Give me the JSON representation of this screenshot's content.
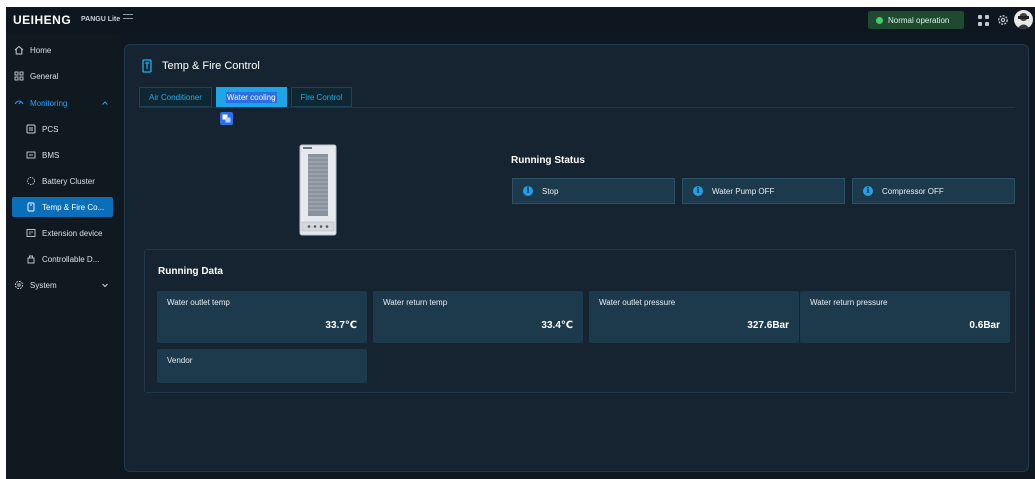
{
  "app": {
    "logo": "UEIHENG",
    "logo_sub": "PANGU Lite",
    "status": "Normal operation"
  },
  "sidebar": {
    "items": [
      {
        "label": "Home",
        "icon": "home-icon"
      },
      {
        "label": "General",
        "icon": "grid-icon"
      },
      {
        "label": "Monitoring",
        "icon": "monitor-icon"
      },
      {
        "label": "PCS",
        "icon": "pcs-icon"
      },
      {
        "label": "BMS",
        "icon": "bms-icon"
      },
      {
        "label": "Battery Cluster",
        "icon": "battery-icon"
      },
      {
        "label": "Temp & Fire Co...",
        "icon": "thermo-icon"
      },
      {
        "label": "Extension device",
        "icon": "extension-icon"
      },
      {
        "label": "Controllable D...",
        "icon": "controllable-icon"
      },
      {
        "label": "System",
        "icon": "system-icon"
      }
    ]
  },
  "panel": {
    "title": "Temp & Fire Control",
    "tabs": [
      "Air Conditioner",
      "Water cooling",
      "Fire Control"
    ],
    "active_tab": "Water cooling"
  },
  "running_status": {
    "title": "Running Status",
    "items": [
      "Stop",
      "Water Pump OFF",
      "Compressor OFF"
    ]
  },
  "running_data": {
    "title": "Running Data",
    "items": [
      {
        "label": "Water outlet temp",
        "value": "33.7℃"
      },
      {
        "label": "Water return temp",
        "value": "33.4℃"
      },
      {
        "label": "Water outlet pressure",
        "value": "327.6Bar"
      },
      {
        "label": "Water return pressure",
        "value": "0.6Bar"
      },
      {
        "label": "Vendor",
        "value": ""
      }
    ]
  },
  "colors": {
    "accent": "#1ca6e6",
    "active_nav": "#0a6fb8",
    "status_green": "#3ecf67",
    "card_bg": "#1d3a4c"
  }
}
